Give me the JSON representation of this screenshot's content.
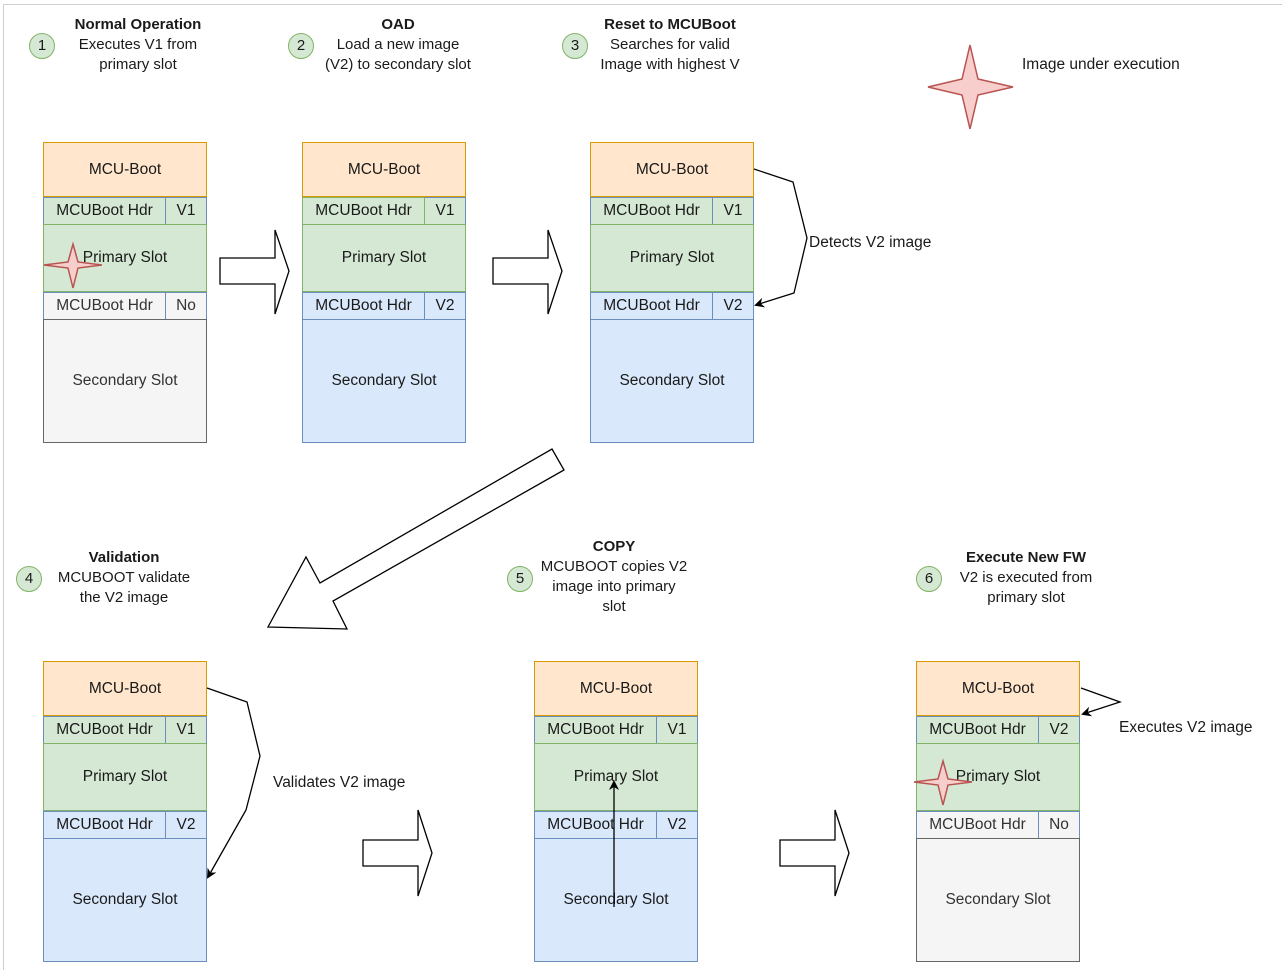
{
  "legend": {
    "icon": "star-icon",
    "label": "Image under execution"
  },
  "colors": {
    "boot_fill": "#ffe6cc",
    "boot_stroke": "#d79b00",
    "primary_fill": "#d5e8d4",
    "primary_stroke": "#82b366",
    "secondary_fill": "#dae8fc",
    "secondary_stroke": "#6c8ebf",
    "empty_fill": "#f5f5f5",
    "empty_stroke": "#666666",
    "star_fill": "#f8cecc",
    "star_stroke": "#b85450"
  },
  "steps": [
    {
      "number": "1",
      "title": "Normal Operation",
      "lines": [
        "Executes V1 from",
        "primary slot"
      ]
    },
    {
      "number": "2",
      "title": "OAD",
      "lines": [
        "Load a new image",
        "(V2) to secondary slot"
      ]
    },
    {
      "number": "3",
      "title": "Reset to MCUBoot",
      "lines": [
        "Searches for valid",
        "Image with highest V"
      ]
    },
    {
      "number": "4",
      "title": "Validation",
      "lines": [
        "MCUBOOT validate",
        "the V2 image"
      ]
    },
    {
      "number": "5",
      "title": "COPY",
      "lines": [
        "MCUBOOT copies V2",
        "image into primary",
        "slot"
      ]
    },
    {
      "number": "6",
      "title": "Execute New FW",
      "lines": [
        "V2 is executed from",
        "primary slot"
      ]
    }
  ],
  "stacks": [
    {
      "boot": "MCU-Boot",
      "hdr1": "MCUBoot Hdr",
      "ver1": "V1",
      "primary": "Primary Slot",
      "hdr2": "MCUBoot Hdr",
      "ver2": "No",
      "secondary": "Secondary Slot"
    },
    {
      "boot": "MCU-Boot",
      "hdr1": "MCUBoot Hdr",
      "ver1": "V1",
      "primary": "Primary Slot",
      "hdr2": "MCUBoot Hdr",
      "ver2": "V2",
      "secondary": "Secondary Slot"
    },
    {
      "boot": "MCU-Boot",
      "hdr1": "MCUBoot Hdr",
      "ver1": "V1",
      "primary": "Primary Slot",
      "hdr2": "MCUBoot Hdr",
      "ver2": "V2",
      "secondary": "Secondary Slot"
    },
    {
      "boot": "MCU-Boot",
      "hdr1": "MCUBoot Hdr",
      "ver1": "V1",
      "primary": "Primary Slot",
      "hdr2": "MCUBoot Hdr",
      "ver2": "V2",
      "secondary": "Secondary Slot"
    },
    {
      "boot": "MCU-Boot",
      "hdr1": "MCUBoot Hdr",
      "ver1": "V1",
      "primary": "Primary Slot",
      "hdr2": "MCUBoot Hdr",
      "ver2": "V2",
      "secondary": "Secondary Slot"
    },
    {
      "boot": "MCU-Boot",
      "hdr1": "MCUBoot Hdr",
      "ver1": "V2",
      "primary": "Primary Slot",
      "hdr2": "MCUBoot Hdr",
      "ver2": "No",
      "secondary": "Secondary Slot"
    }
  ],
  "annotations": {
    "detects": "Detects V2 image",
    "validates": "Validates V2 image",
    "executes": "Executes V2 image"
  }
}
